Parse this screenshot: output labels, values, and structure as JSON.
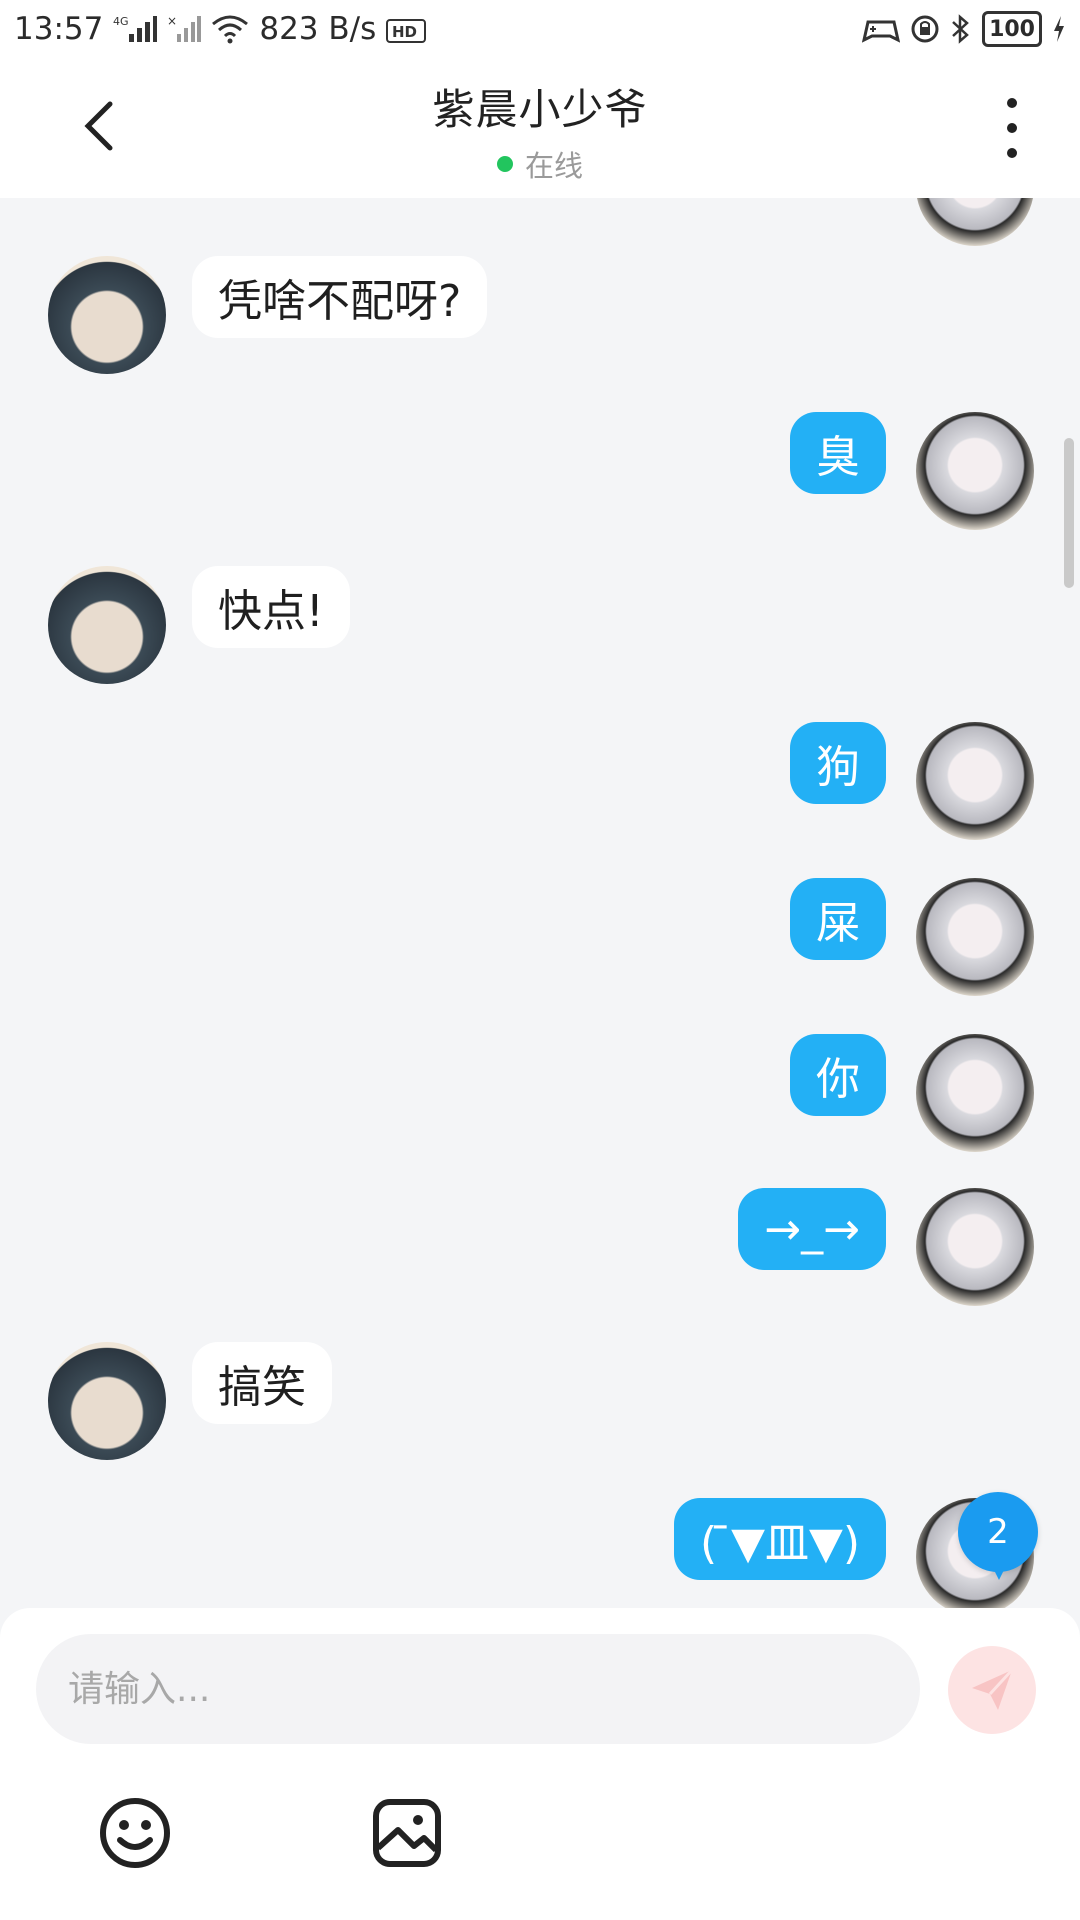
{
  "status_bar": {
    "time": "13:57",
    "signal_label": "4G",
    "network_speed": "823 B/s",
    "hd_label": "HD",
    "battery": "100"
  },
  "header": {
    "title": "紫晨小少爷",
    "status": "在线",
    "status_color": "#22c55e"
  },
  "messages": [
    {
      "side": "in",
      "text": "凭啥不配呀?"
    },
    {
      "side": "out",
      "text": "臭"
    },
    {
      "side": "in",
      "text": "快点!"
    },
    {
      "side": "out",
      "text": "狗"
    },
    {
      "side": "out",
      "text": "屎"
    },
    {
      "side": "out",
      "text": "你"
    },
    {
      "side": "out",
      "text": "→_→"
    },
    {
      "side": "in",
      "text": "搞笑"
    },
    {
      "side": "out",
      "text": "( ̄▼皿▼)"
    }
  ],
  "unread_count": "2",
  "composer": {
    "placeholder": "请输入..."
  },
  "colors": {
    "outgoing_bubble": "#23b0f5",
    "incoming_bubble": "#ffffff",
    "chat_background": "#f4f5f7",
    "badge": "#1a9bf0",
    "send_button": "#fde3e3"
  }
}
